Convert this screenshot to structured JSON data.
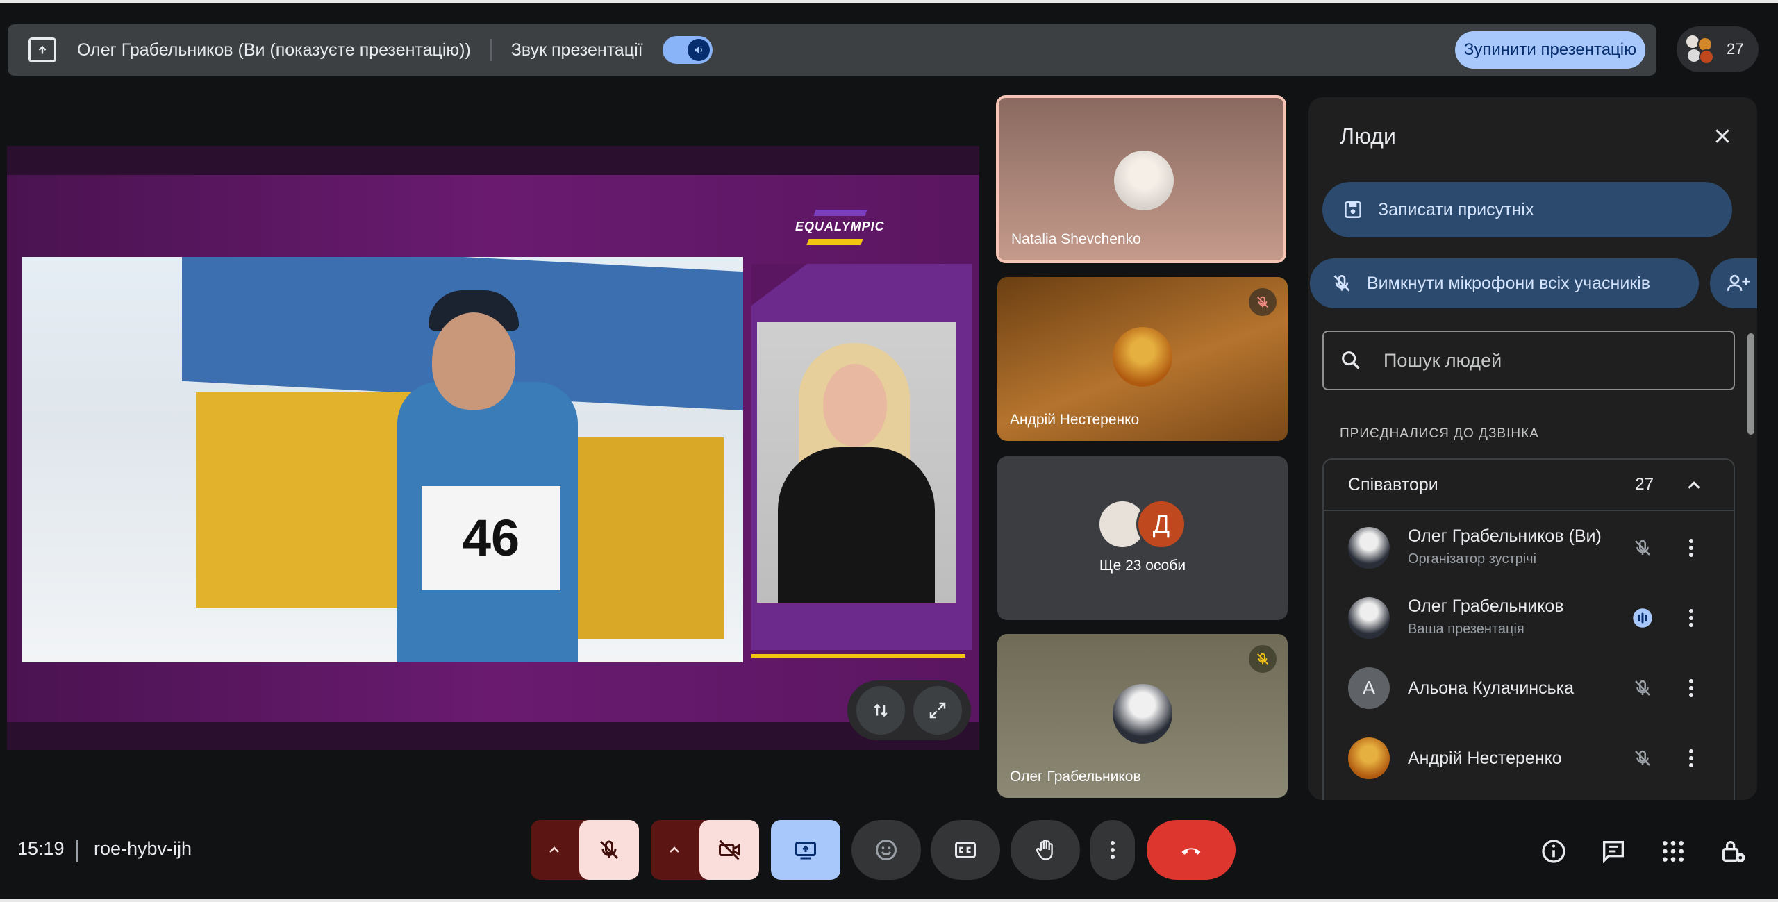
{
  "topbar": {
    "presenting_title": "Олег Грабельников (Ви (показуєте презентацію))",
    "audio_label": "Звук презентації",
    "stop_button": "Зупинити презентацію",
    "participant_count": "27"
  },
  "slide": {
    "logo_text": "EQUALYMPIC",
    "bib_number": "46"
  },
  "tiles": [
    {
      "name": "Natalia Shevchenko",
      "muted": false
    },
    {
      "name": "Андрій Нестеренко",
      "muted": true
    },
    {
      "more_label": "Ще 23 особи",
      "avatar_letter": "Д"
    },
    {
      "name": "Олег Грабельников",
      "muted": true
    }
  ],
  "people_panel": {
    "title": "Люди",
    "record_attendance": "Записати присутніх",
    "mute_all": "Вимкнути мікрофони всіх учасників",
    "search_placeholder": "Пошук людей",
    "section_label": "ПРИЄДНАЛИСЯ ДО ДЗВІНКА",
    "group_name": "Співавтори",
    "group_count": "27",
    "people": [
      {
        "name": "Олег Грабельников (Ви)",
        "subtitle": "Організатор зустрічі",
        "mic": "off"
      },
      {
        "name": "Олег Грабельников",
        "subtitle": "Ваша презентація",
        "mic": "speaking"
      },
      {
        "name": "Альона Кулачинська",
        "subtitle": "",
        "mic": "off",
        "avatar_letter": "А"
      },
      {
        "name": "Андрій Нестеренко",
        "subtitle": "",
        "mic": "off"
      }
    ]
  },
  "bottom": {
    "time": "15:19",
    "meeting_code": "roe-hybv-ijh"
  },
  "colors": {
    "end_call": "#dc362e",
    "accent_blue": "#a8c7fa",
    "muted_red_bg": "#5b1613"
  },
  "icons": [
    "present-icon",
    "volume-icon",
    "close-icon",
    "save-icon",
    "mic-off-icon",
    "add-person-icon",
    "search-icon",
    "chevron-up-icon",
    "more-vert-icon",
    "camera-off-icon",
    "emoji-icon",
    "captions-icon",
    "hand-icon",
    "call-end-icon",
    "info-icon",
    "chat-icon",
    "apps-icon",
    "lock-icon"
  ]
}
